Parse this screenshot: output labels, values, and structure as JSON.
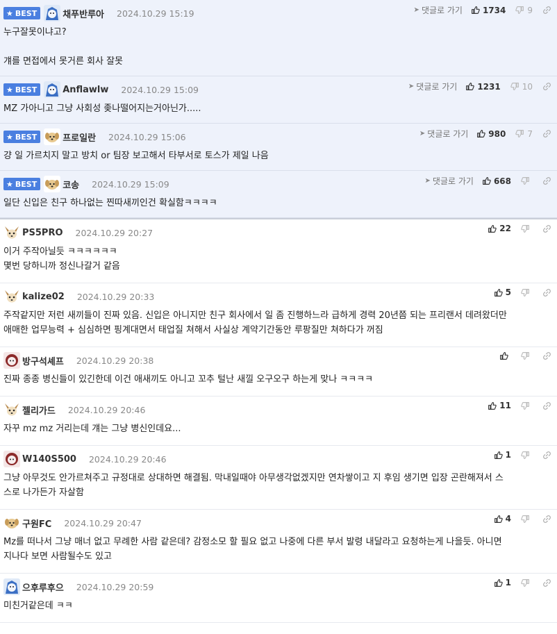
{
  "best_label": "BEST",
  "goto_label": "댓글로 가기",
  "best_comments": [
    {
      "nick": "채푸반루아",
      "date": "2024.10.29 15:19",
      "likes": "1734",
      "dislikes": "9",
      "lines": [
        "누구잘못이냐고?",
        "",
        "걔를 면접에서 못거른 회사 잘못"
      ]
    },
    {
      "nick": "Anflawlw",
      "date": "2024.10.29 15:09",
      "likes": "1231",
      "dislikes": "10",
      "lines": [
        "MZ 가아니고 그냥 사회성 좆나떨어지는거아닌가....."
      ]
    },
    {
      "nick": "프로일란",
      "date": "2024.10.29 15:06",
      "likes": "980",
      "dislikes": "7",
      "lines": [
        "걍 일 가르치지 말고 방치 or 팀장 보고해서 타부서로 토스가 제일 나음"
      ]
    },
    {
      "nick": "코송",
      "date": "2024.10.29 15:09",
      "likes": "668",
      "dislikes": "",
      "lines": [
        "일단 신입은 친구 하나없는 찐따새끼인건 확실함ㅋㅋㅋㅋ"
      ]
    }
  ],
  "comments": [
    {
      "nick": "PS5PRO",
      "date": "2024.10.29 20:27",
      "likes": "22",
      "lines": [
        "이거 주작아닐듯 ㅋㅋㅋㅋㅋㅋ",
        "몇번 당하니까 정신나갈거 같음"
      ]
    },
    {
      "nick": "kalize02",
      "date": "2024.10.29 20:33",
      "likes": "5",
      "lines": [
        "주작같지만 저런 새끼들이 진짜 있음. 신입은 아니지만 친구 회사에서 일 좀 진행하느라 급하게 경력 20년쯤 되는 프리랜서 데려왔더만",
        "애매한 업무능력 + 심심하면 핑계대면서 태업질 쳐해서 사실상 계약기간동안 루팡질만 쳐하다가 꺼짐"
      ]
    },
    {
      "nick": "방구석셰프",
      "date": "2024.10.29 20:38",
      "likes": "",
      "lines": [
        "진짜 종종 병신들이 있긴한데 이건 애새끼도 아니고 꼬추 털난 새낄 오구오구 하는게 맞나 ㅋㅋㅋㅋ"
      ]
    },
    {
      "nick": "젤리가드",
      "date": "2024.10.29 20:46",
      "likes": "11",
      "lines": [
        "자꾸 mz mz 거리는데 걔는 그냥 병신인데요..."
      ]
    },
    {
      "nick": "W140S500",
      "date": "2024.10.29 20:46",
      "likes": "1",
      "lines": [
        "그냥 아무것도 안가르쳐주고 규정대로 상대하면 해결됨. 막내일때야 아무생각없겠지만 연차쌓이고 지 후임 생기면 입장 곤란해져서 스",
        "스로 나가든가 자살함"
      ]
    },
    {
      "nick": "구원FC",
      "date": "2024.10.29 20:47",
      "likes": "4",
      "lines": [
        "Mz를 떠나서 그냥 매너 없고 무례한 사람 같은데? 감정소모 할 필요 없고 나중에 다른 부서 발령 내달라고 요청하는게 나을듯. 아니면",
        "지나다 보면 사람될수도 있고"
      ]
    },
    {
      "nick": "으후루후으",
      "date": "2024.10.29 20:59",
      "likes": "1",
      "lines": [
        "미친거같은데 ㅋㅋ"
      ]
    }
  ],
  "avatars": [
    "blue-character-avatar",
    "blue-character-avatar",
    "puppy-avatar",
    "puppy-avatar",
    "chihuahua-avatar",
    "chihuahua-avatar",
    "red-character-avatar",
    "chihuahua-avatar",
    "red-character-avatar",
    "puppy-avatar",
    "blue-character-avatar"
  ],
  "colors": {
    "best_badge": "#4a7fe0",
    "best_bg": "#eef2fb"
  }
}
